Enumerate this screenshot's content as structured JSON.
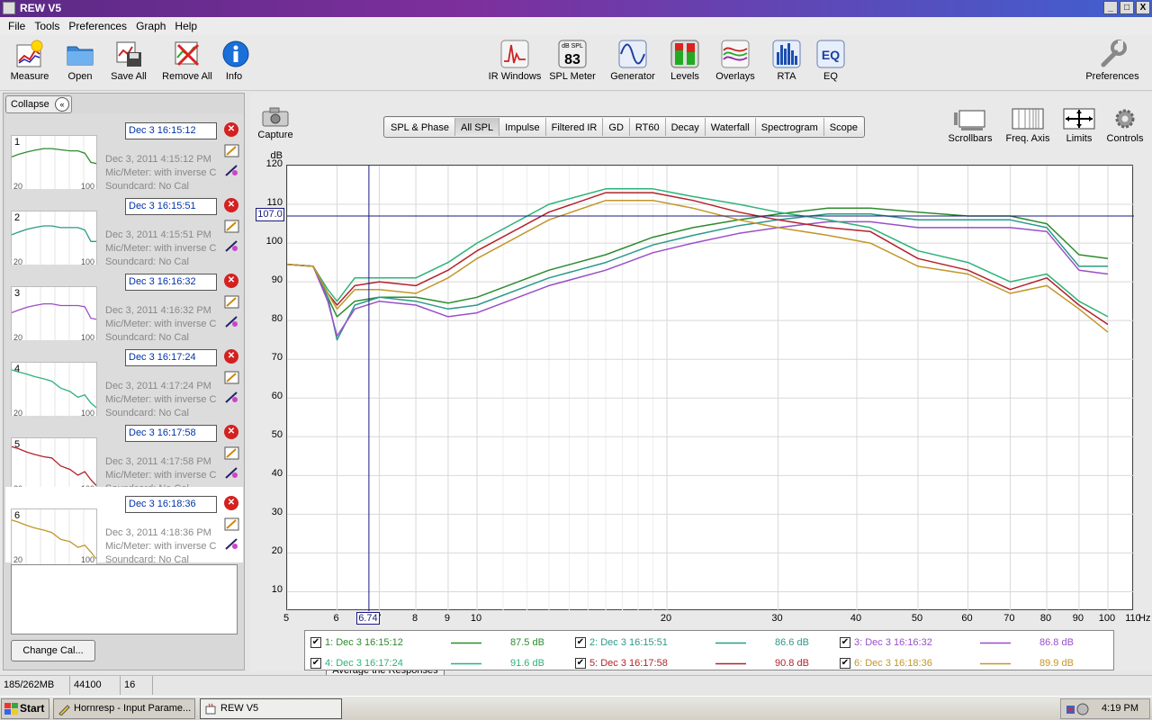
{
  "window": {
    "title": "REW V5",
    "buttons": [
      "_",
      "□",
      "X"
    ]
  },
  "menu": [
    "File",
    "Tools",
    "Preferences",
    "Graph",
    "Help"
  ],
  "toolbar": {
    "left": [
      "Measure",
      "Open",
      "Save All",
      "Remove All",
      "Info"
    ],
    "center": [
      "IR Windows",
      "SPL Meter",
      "Generator",
      "Levels",
      "Overlays",
      "RTA",
      "EQ"
    ],
    "spl_meter_top": "dB SPL",
    "spl_meter_value": "83",
    "eq_icon_text": "EQ",
    "preferences": "Preferences"
  },
  "left_panel": {
    "collapse_label": "Collapse",
    "measurements": [
      {
        "num": "1",
        "name": "Dec 3 16:15:12",
        "date": "Dec 3, 2011 4:15:12 PM",
        "mic": "Mic/Meter: with inverse C",
        "sound": "Soundcard: No Cal",
        "color": "#2e8b2e"
      },
      {
        "num": "2",
        "name": "Dec 3 16:15:51",
        "date": "Dec 3, 2011 4:15:51 PM",
        "mic": "Mic/Meter: with inverse C",
        "sound": "Soundcard: No Cal",
        "color": "#2a9a8a"
      },
      {
        "num": "3",
        "name": "Dec 3 16:16:32",
        "date": "Dec 3, 2011 4:16:32 PM",
        "mic": "Mic/Meter: with inverse C",
        "sound": "Soundcard: No Cal",
        "color": "#9a4fc8"
      },
      {
        "num": "4",
        "name": "Dec 3 16:17:24",
        "date": "Dec 3, 2011 4:17:24 PM",
        "mic": "Mic/Meter: with inverse C",
        "sound": "Soundcard: No Cal",
        "color": "#2db37a"
      },
      {
        "num": "5",
        "name": "Dec 3 16:17:58",
        "date": "Dec 3, 2011 4:17:58 PM",
        "mic": "Mic/Meter: with inverse C",
        "sound": "Soundcard: No Cal",
        "color": "#b2232a"
      },
      {
        "num": "6",
        "name": "Dec 3 16:18:36",
        "date": "Dec 3, 2011 4:18:36 PM",
        "mic": "Mic/Meter: with inverse C",
        "sound": "Soundcard: No Cal",
        "color": "#c2962a"
      }
    ],
    "thumb_x_min": "20",
    "thumb_x_max": "100",
    "change_cal_label": "Change Cal..."
  },
  "main": {
    "capture_label": "Capture",
    "tabs": [
      "SPL & Phase",
      "All SPL",
      "Impulse",
      "Filtered IR",
      "GD",
      "RT60",
      "Decay",
      "Waterfall",
      "Spectrogram",
      "Scope"
    ],
    "selected_tab": "All SPL",
    "right_tools": [
      "Scrollbars",
      "Freq. Axis",
      "Limits",
      "Controls"
    ],
    "average_button": "Average the Responses",
    "cursor_y": "107.0",
    "cursor_x": "6.74"
  },
  "chart_data": {
    "type": "line",
    "ylabel": "dB",
    "xunit": "Hz",
    "xscale": "log",
    "xlim": [
      5,
      110
    ],
    "ylim": [
      5,
      120
    ],
    "y_ticks": [
      10,
      20,
      30,
      40,
      50,
      60,
      70,
      80,
      90,
      100,
      110,
      120
    ],
    "x_ticks": [
      "5",
      "6",
      "7",
      "8",
      "9",
      "10",
      "20",
      "30",
      "40",
      "50",
      "60",
      "70",
      "80",
      "90",
      "100",
      "110"
    ],
    "grid": true,
    "series": [
      {
        "name": "1: Dec 3 16:15:12",
        "color": "#2e8b2e",
        "x": [
          5,
          5.5,
          5.8,
          6,
          6.4,
          7,
          8,
          9,
          10,
          13,
          16,
          19,
          22,
          26,
          30,
          36,
          42,
          50,
          60,
          70,
          80,
          90,
          100
        ],
        "y": [
          94.5,
          94,
          86,
          81,
          85,
          86,
          86,
          84.5,
          86,
          93,
          97,
          101.5,
          104,
          106,
          107.5,
          109,
          109,
          108,
          107,
          107,
          105,
          97,
          96
        ]
      },
      {
        "name": "2: Dec 3 16:15:51",
        "color": "#2a9a8a",
        "x": [
          5,
          5.5,
          5.8,
          6,
          6.4,
          7,
          8,
          9,
          10,
          13,
          16,
          19,
          22,
          26,
          30,
          36,
          42,
          50,
          60,
          70,
          80,
          90,
          100
        ],
        "y": [
          94.5,
          94,
          86,
          75,
          84,
          86,
          85,
          83,
          84,
          91,
          95,
          99.5,
          102,
          104.5,
          106,
          107.5,
          107.5,
          106,
          106,
          106,
          104,
          94,
          94
        ]
      },
      {
        "name": "3: Dec 3 16:16:32",
        "color": "#9a4fc8",
        "x": [
          5,
          5.5,
          5.8,
          6,
          6.4,
          7,
          8,
          9,
          10,
          13,
          16,
          19,
          22,
          26,
          30,
          36,
          42,
          50,
          60,
          70,
          80,
          90,
          100
        ],
        "y": [
          94.5,
          94,
          85,
          76,
          83,
          85,
          84,
          81,
          82,
          89,
          93,
          97.5,
          100,
          102.5,
          104,
          105.5,
          105.5,
          104,
          104,
          104,
          103,
          93,
          92
        ]
      },
      {
        "name": "4: Dec 3 16:17:24",
        "color": "#2db37a",
        "x": [
          5,
          5.5,
          5.8,
          6,
          6.4,
          7,
          8,
          9,
          10,
          13,
          16,
          19,
          22,
          26,
          30,
          36,
          42,
          50,
          60,
          70,
          80,
          90,
          100
        ],
        "y": [
          94.5,
          94,
          88,
          85,
          91,
          91,
          91,
          95,
          100,
          110,
          114,
          114,
          112,
          110,
          108,
          106,
          104,
          98,
          95,
          90,
          92,
          85,
          81
        ]
      },
      {
        "name": "5: Dec 3 16:17:58",
        "color": "#b2232a",
        "x": [
          5,
          5.5,
          5.8,
          6,
          6.4,
          7,
          8,
          9,
          10,
          13,
          16,
          19,
          22,
          26,
          30,
          36,
          42,
          50,
          60,
          70,
          80,
          90,
          100
        ],
        "y": [
          94.5,
          94,
          87,
          84,
          89,
          90,
          89,
          93,
          98,
          108,
          113,
          113,
          111,
          108,
          106,
          104,
          103,
          96,
          93,
          88,
          91,
          84,
          79
        ]
      },
      {
        "name": "6: Dec 3 16:18:36",
        "color": "#c2962a",
        "x": [
          5,
          5.5,
          5.8,
          6,
          6.4,
          7,
          8,
          9,
          10,
          13,
          16,
          19,
          22,
          26,
          30,
          36,
          42,
          50,
          60,
          70,
          80,
          90,
          100
        ],
        "y": [
          94.5,
          94,
          87,
          83,
          88,
          88,
          87,
          91,
          96,
          106,
          111,
          111,
          109,
          106,
          104,
          102,
          100,
          94,
          92,
          87,
          89,
          83,
          77
        ]
      }
    ]
  },
  "legend": [
    {
      "label": "1: Dec 3 16:15:12",
      "value": "87.5 dB",
      "color": "#2e8b2e"
    },
    {
      "label": "2: Dec 3 16:15:51",
      "value": "86.6 dB",
      "color": "#2a9a8a"
    },
    {
      "label": "3: Dec 3 16:16:32",
      "value": "86.8 dB",
      "color": "#9a4fc8"
    },
    {
      "label": "4: Dec 3 16:17:24",
      "value": "91.6 dB",
      "color": "#2db37a"
    },
    {
      "label": "5: Dec 3 16:17:58",
      "value": "90.8 dB",
      "color": "#b2232a"
    },
    {
      "label": "6: Dec 3 16:18:36",
      "value": "89.9 dB",
      "color": "#c2962a"
    }
  ],
  "status": {
    "memory": "185/262MB",
    "rate": "44100 Hz",
    "bits": "16 Bit"
  },
  "taskbar": {
    "start": "Start",
    "tasks": [
      "Hornresp - Input Parame...",
      "REW V5"
    ],
    "clock": "4:19 PM"
  }
}
